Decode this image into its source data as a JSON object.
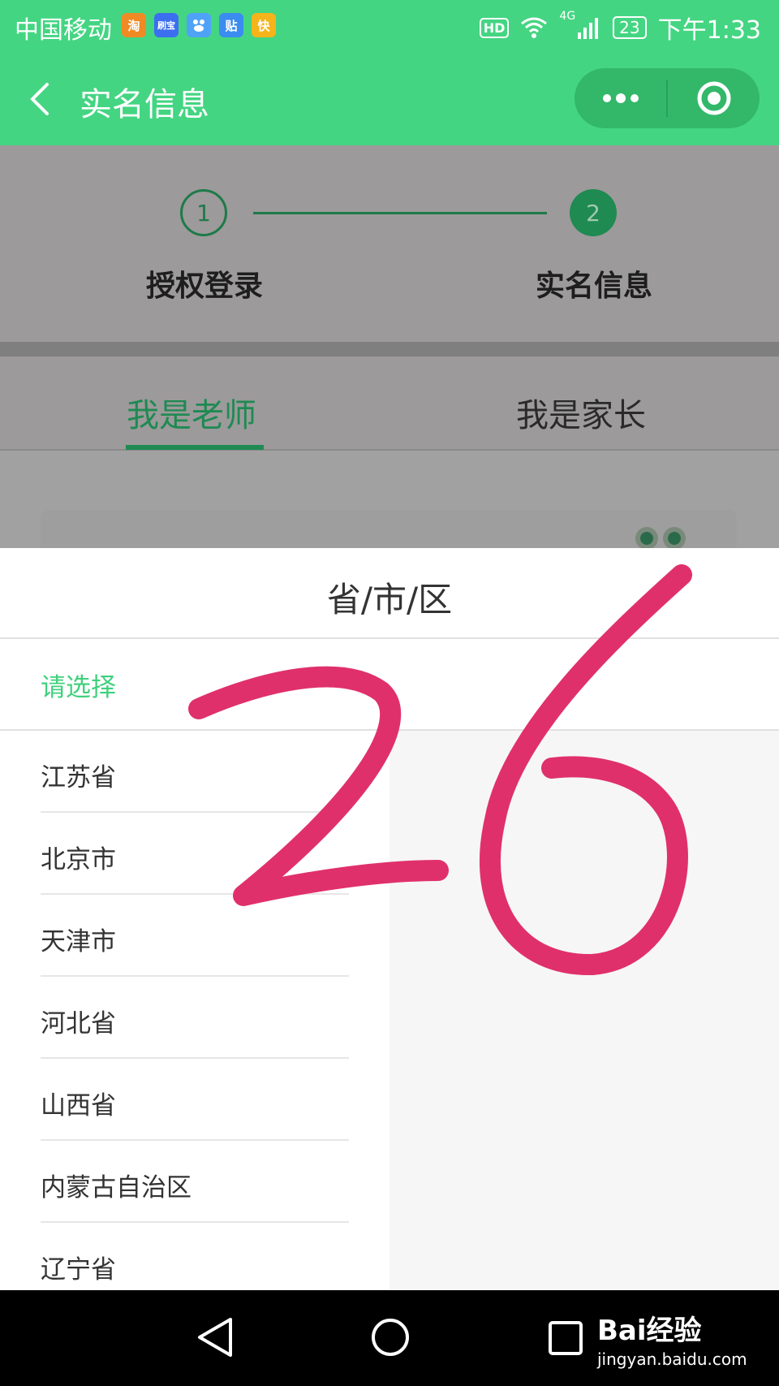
{
  "status_bar": {
    "carrier": "中国移动",
    "app_icons": [
      {
        "label": "淘",
        "color": "#f08a24"
      },
      {
        "label": "刷宝",
        "color": "#3b6ff0"
      },
      {
        "label": "",
        "color": "#4fa3f7"
      },
      {
        "label": "贴",
        "color": "#3b8cf0"
      },
      {
        "label": "快",
        "color": "#f4b41a"
      }
    ],
    "hd": "HD",
    "network": "4G",
    "battery": "23",
    "time": "下午1:33"
  },
  "nav_bar": {
    "title": "实名信息",
    "background": "#44d582"
  },
  "steps": [
    {
      "number": "1",
      "label": "授权登录"
    },
    {
      "number": "2",
      "label": "实名信息"
    }
  ],
  "tabs": [
    {
      "label": "我是老师",
      "active": true
    },
    {
      "label": "我是家长",
      "active": false
    }
  ],
  "picker": {
    "title": "省/市/区",
    "prompt": "请选择",
    "items": [
      "江苏省",
      "北京市",
      "天津市",
      "河北省",
      "山西省",
      "内蒙古自治区",
      "辽宁省"
    ]
  },
  "annotation": {
    "text": "26",
    "color": "#e0306c"
  },
  "watermark": {
    "logo": "Bai经验",
    "site": "jingyan.baidu.com"
  }
}
